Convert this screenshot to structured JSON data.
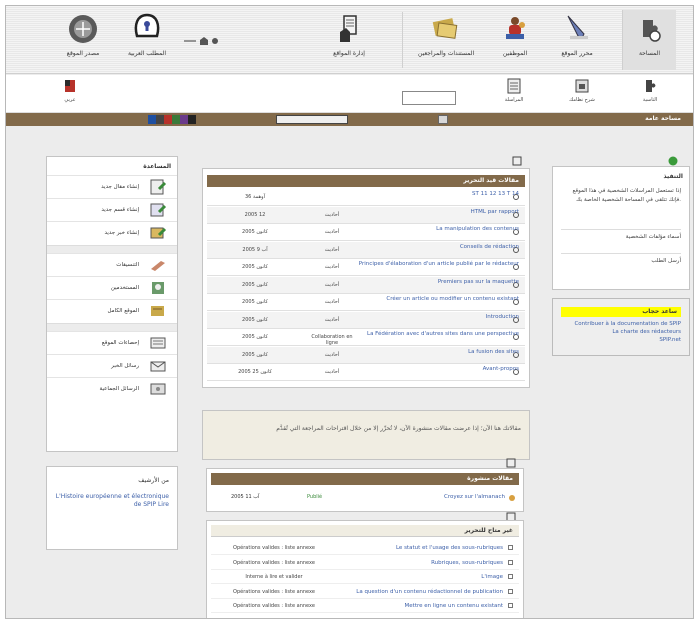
{
  "top_nav": [
    {
      "label": "مصدر الموقع",
      "icon": "globe-icon"
    },
    {
      "label": "المطلب العربية",
      "icon": "keyhole-icon"
    },
    {
      "label": "إدارة المواقع",
      "icon": "document-hand-icon"
    },
    {
      "label": "المستندات والمراجعين",
      "icon": "folders-icon"
    },
    {
      "label": "الموظفين",
      "icon": "people-icon"
    },
    {
      "label": "محرر الموقع",
      "icon": "pen-icon"
    },
    {
      "label": "المساحة",
      "icon": "puzzle-hand-icon"
    }
  ],
  "second_bar": [
    {
      "label": "عربي",
      "icon": "flag-icon"
    },
    {
      "label": "المراسلة",
      "icon": "inbox-icon"
    },
    {
      "label": "شرح نظامك",
      "icon": "calendar-icon"
    },
    {
      "label": "التاسية",
      "icon": "puzzle-small-icon"
    }
  ],
  "breadcrumb": "مساحة عامة",
  "right_panel": {
    "title": "التنفيذ",
    "text": "إذا تستعمل المراسلات الشخصية في هذا الموقع فإنك تتلقى في المساحة الشخصية الخاصة بك.",
    "rows": [
      "أسماء مؤلفات الشخصية",
      "أرسل الطلب"
    ]
  },
  "help_panel": {
    "title": "ساعد حجاب",
    "links": [
      "Contribuer à la documentation de SPIP",
      "La charte des rédacteurs",
      "SPIP.net"
    ]
  },
  "left_panel": {
    "title": "المساعدة",
    "items": [
      "إنشاء مقال جديد",
      "إنشاء قسم جديد",
      "إنشاء خبر جديد",
      "التنسيقات",
      "المستخدمين",
      "الموقع الكامل",
      "إحصاءات الموقع",
      "رسائل الخبر",
      "الرسائل الجماعية"
    ]
  },
  "left_panel2": {
    "header": "من الأرشيف",
    "link": "L'Histoire européenne et électronique de SPIP Lire"
  },
  "main_table": {
    "title": "مقالات قيد التحرير",
    "rows": [
      {
        "title": "ST 11 12 13 T 14",
        "status": "",
        "date": "آوهمة 36"
      },
      {
        "title": "HTML par rapport",
        "status": "أحاديث",
        "date": "2005 12"
      },
      {
        "title": "La manipulation des contenus",
        "status": "أحاديث",
        "date": "2005 كانون"
      },
      {
        "title": "Conseils de rédaction",
        "status": "أحاديث",
        "date": "2005 آب 9"
      },
      {
        "title": "Principes d'élaboration d'un article publié par le rédacteur",
        "status": "أحاديث",
        "date": "2005 كانون"
      },
      {
        "title": "Premiers pas sur la maquette",
        "status": "أحاديث",
        "date": "2005 كانون"
      },
      {
        "title": "Créer un article ou modifier un contenu existant",
        "status": "أحاديث",
        "date": "2005 كانون"
      },
      {
        "title": "Introduction",
        "status": "أحاديث",
        "date": "2005 كانون"
      },
      {
        "title": "La Fédération avec d'autres sites dans une perspective",
        "status": "Collaboration en ligne",
        "date": "2005 كانون"
      },
      {
        "title": "La fusion des sites",
        "status": "أحاديث",
        "date": "2005 كانون"
      },
      {
        "title": "Avant-propos",
        "status": "أحاديث",
        "date": "2005 كانون 25"
      }
    ]
  },
  "notice": "مقالاتك هنا الآن؛ إذا عرضت مقالات منشورة الآن، لا تُحرِّر إلا من خلال اقتراحات المراجعة التي تُقدَّم",
  "published": {
    "title": "مقالات منشورة",
    "row": {
      "title": "Croyez sur l'almanach",
      "status": "Publié",
      "date": "2005 آب 11"
    }
  },
  "tracking": {
    "title": "غير متاح للتحرير",
    "rows": [
      {
        "title": "Le statut et l'usage des sous-rubriques",
        "status": "Opérations valides : liste annexe"
      },
      {
        "title": "Rubriques, sous-rubriques",
        "status": "Opérations valides : liste annexe"
      },
      {
        "title": "L'image",
        "status": "Interne à lire et valider"
      },
      {
        "title": "La question d'un contenu rédactionnel de publication",
        "status": "Opérations valides : liste annexe"
      },
      {
        "title": "Mettre en ligne un contenu existant",
        "status": "Opérations valides : liste annexe"
      }
    ]
  },
  "colors": {
    "brown": "#826a4a",
    "link": "#3c5fa8",
    "yellow": "#ffff00"
  }
}
